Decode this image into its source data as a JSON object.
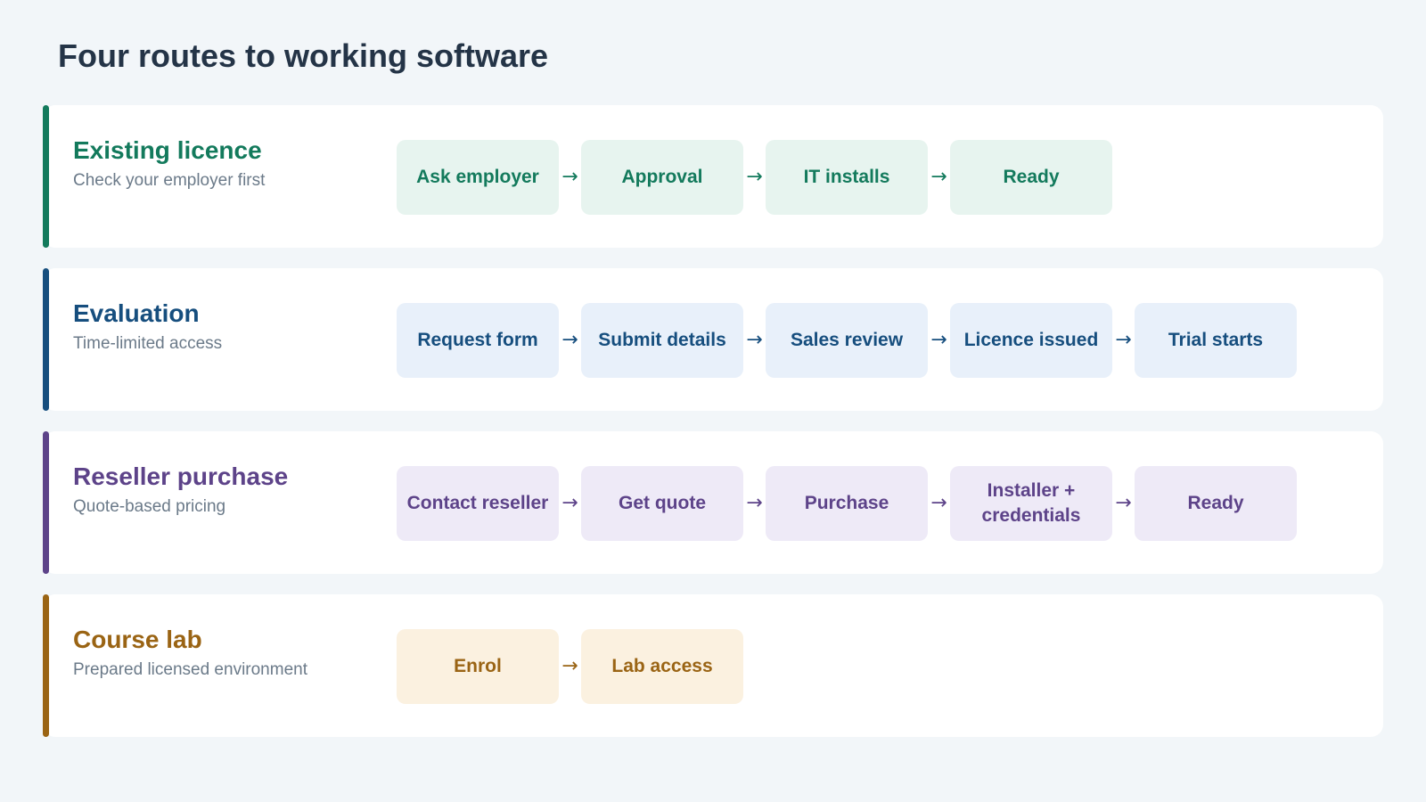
{
  "title": "Four routes to working software",
  "arrow_glyph": "→",
  "routes": [
    {
      "name": "Existing licence",
      "subtitle": "Check your employer first",
      "accent": "#137a5c",
      "step_bg": "#e7f4ef",
      "steps": [
        "Ask employer",
        "Approval",
        "IT installs",
        "Ready"
      ]
    },
    {
      "name": "Evaluation",
      "subtitle": "Time-limited access",
      "accent": "#164e7e",
      "step_bg": "#e8f0fa",
      "steps": [
        "Request form",
        "Submit details",
        "Sales review",
        "Licence issued",
        "Trial starts"
      ]
    },
    {
      "name": "Reseller purchase",
      "subtitle": "Quote-based pricing",
      "accent": "#5d4389",
      "step_bg": "#eeeaf7",
      "steps": [
        "Contact reseller",
        "Get quote",
        "Purchase",
        "Installer + credentials",
        "Ready"
      ]
    },
    {
      "name": "Course lab",
      "subtitle": "Prepared licensed environment",
      "accent": "#9a6414",
      "step_bg": "#fbf1e0",
      "steps": [
        "Enrol",
        "Lab access"
      ]
    }
  ]
}
